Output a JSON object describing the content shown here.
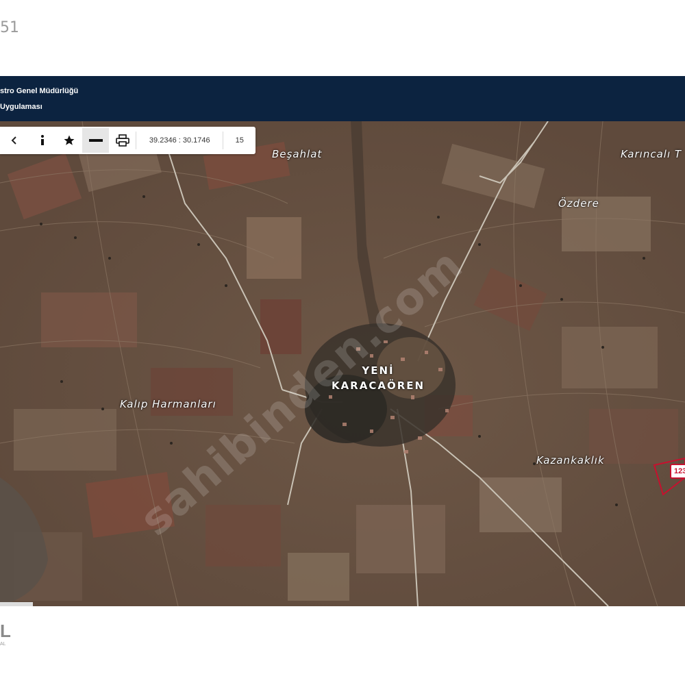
{
  "page_number": "51",
  "header": {
    "line1": "stro Genel Müdürlüğü",
    "line2": "Uygulaması"
  },
  "toolbar": {
    "buttons": [
      {
        "name": "back-icon",
        "glyph": "◀"
      },
      {
        "name": "info-icon",
        "glyph": "i"
      },
      {
        "name": "star-icon",
        "glyph": "★"
      },
      {
        "name": "measure-line-icon",
        "glyph": "—"
      },
      {
        "name": "print-icon",
        "glyph": "⎙"
      }
    ],
    "coordinates": "39.2346 : 30.1746",
    "zoom_level": "15"
  },
  "map": {
    "places": {
      "besahlat": "Beşahlat",
      "karincali": "Karıncalı T",
      "ozdere": "Özdere",
      "kalip": "Kalıp Harmanları",
      "kazankaklik": "Kazankaklık"
    },
    "village": {
      "line1": "YENİ",
      "line2": "KARACAÖREN"
    },
    "parcel_label": "123",
    "watermark": "sahibinden.com"
  },
  "footer": {
    "mark": "L",
    "sub": "AL"
  },
  "colors": {
    "header_bg": "#0c2340",
    "parcel_border": "#c8102e",
    "map_base": "#705c4a"
  }
}
